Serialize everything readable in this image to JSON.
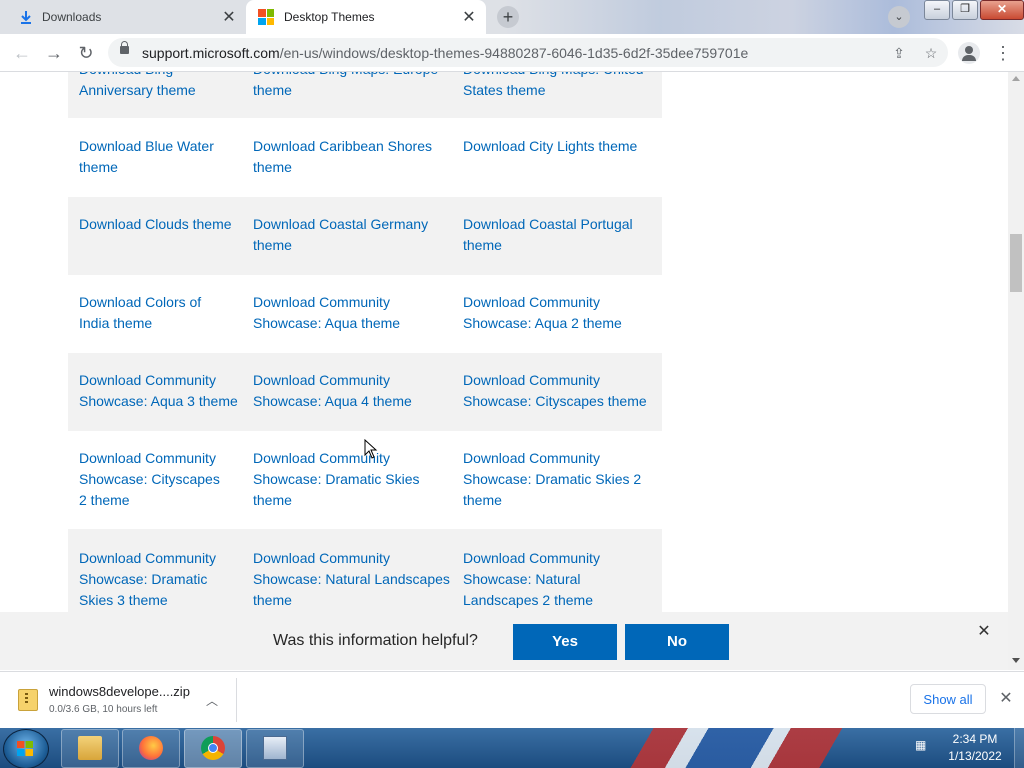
{
  "browser": {
    "tabs": [
      {
        "label": "Downloads",
        "active": false
      },
      {
        "label": "Desktop Themes",
        "active": true
      }
    ],
    "url_domain": "support.microsoft.com",
    "url_path": "/en-us/windows/desktop-themes-94880287-6046-1d35-6d2f-35dee759701e"
  },
  "themes": {
    "row0": {
      "c1": "Download Bing Anniversary theme",
      "c2": "Download Bing Maps: Europe theme",
      "c3": "Download Bing Maps: United States theme"
    },
    "row1": {
      "c1": "Download Blue Water theme",
      "c2": "Download Caribbean Shores theme",
      "c3": "Download City Lights theme"
    },
    "row2": {
      "c1": "Download Clouds theme",
      "c2": "Download Coastal Germany theme",
      "c3": "Download Coastal Portugal theme"
    },
    "row3": {
      "c1": "Download Colors of India theme",
      "c2": "Download Community Showcase: Aqua theme",
      "c3": "Download Community Showcase: Aqua 2 theme"
    },
    "row4": {
      "c1": "Download Community Showcase: Aqua 3 theme",
      "c2": "Download Community Showcase: Aqua 4 theme",
      "c3": "Download Community Showcase: Cityscapes theme"
    },
    "row5": {
      "c1": "Download Community Showcase: Cityscapes 2 theme",
      "c2": "Download Community Showcase: Dramatic Skies theme",
      "c3": "Download Community Showcase: Dramatic Skies 2 theme"
    },
    "row6": {
      "c1": "Download Community Showcase: Dramatic Skies 3 theme",
      "c2": "Download Community Showcase: Natural Landscapes theme",
      "c3": "Download Community Showcase: Natural Landscapes 2 theme"
    }
  },
  "feedback": {
    "question": "Was this information helpful?",
    "yes": "Yes",
    "no": "No"
  },
  "download_shelf": {
    "file_name": "windows8develope....zip",
    "status": "0.0/3.6 GB, 10 hours left",
    "show_all": "Show all"
  },
  "taskbar": {
    "time": "2:34 PM",
    "date": "1/13/2022"
  },
  "colors": {
    "link": "#0067b8",
    "button": "#0067b8",
    "shaded_row": "#f2f2f2"
  }
}
